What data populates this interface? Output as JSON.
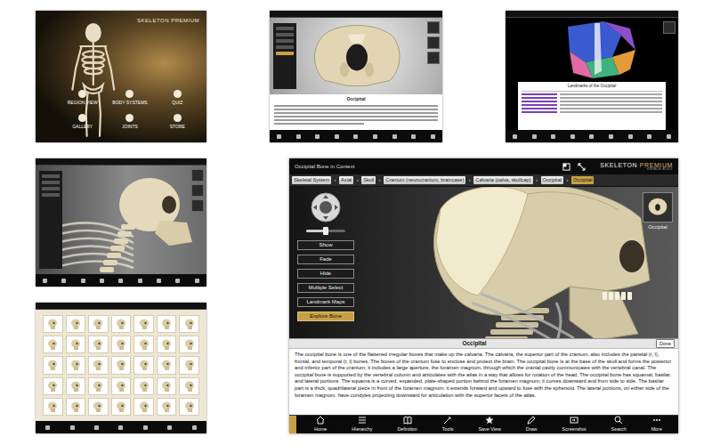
{
  "home_screen": {
    "logo": "SKELETON PREMIUM",
    "menu": [
      {
        "label": "REGION VIEW"
      },
      {
        "label": "BODY SYSTEMS"
      },
      {
        "label": "QUIZ"
      },
      {
        "label": "GALLERY"
      },
      {
        "label": "JOINTS"
      },
      {
        "label": "STORE"
      }
    ]
  },
  "bone_screen": {
    "caption": "Occipital"
  },
  "landmark_screen": {
    "title": "Landmarks of the Occipital"
  },
  "main": {
    "title": "Occipital Bone in Context",
    "logo_word1": "SKELETON",
    "logo_word2": "PREMIUM",
    "logo_sub": "VISIBLE BODY",
    "breadcrumb_separator": "›",
    "breadcrumb": [
      {
        "label": "Skeletal System",
        "selected": false
      },
      {
        "label": "Axial",
        "selected": false
      },
      {
        "label": "Skull",
        "selected": false
      },
      {
        "label": "Cranium (neurocranium, braincase)",
        "selected": false
      },
      {
        "label": "Calvaria (calva, skullcap)",
        "selected": false
      },
      {
        "label": "Occipital",
        "selected": false
      },
      {
        "label": "Occipital",
        "selected": true
      }
    ],
    "zoom_level": 0.5,
    "controls": [
      {
        "label": "Show",
        "selected": false
      },
      {
        "label": "Fade",
        "selected": false
      },
      {
        "label": "Hide",
        "selected": false
      },
      {
        "label": "Multiple Select",
        "selected": false
      },
      {
        "label": "Landmark Maps",
        "selected": false
      },
      {
        "label": "Explore Bone",
        "selected": true
      }
    ],
    "thumbnail_label": "Occipital",
    "info_title": "Occipital",
    "done": "Done",
    "description": "The occipital bone is one of the flattened irregular bones that make up the calvaria. The calvaria, the superior part of the cranium, also includes the parietal (r, l), frontal, and temporal (r, l) bones. The bones of the cranium fuse to enclose and protect the brain. The occipital bone is at the base of the skull and forms the posterior and inferior part of the cranium; it includes a large aperture, the foramen magnum, through which the cranial cavity communicates with the vertebral canal. The occipital bone is supported by the vertebral column and articulates with the atlas in a way that allows for rotation of the head. The occipital bone has squamal, basilar, and lateral portions. The squama is a curved, expanded, plate-shaped portion behind the foramen magnum; it curves downward and from side to side. The basilar part is a thick, quadrilateral piece in front of the foramen magnum; it extends forward and upward to fuse with the sphenoid. The lateral portions, on either side of the foramen magnum, have condyles projecting downward for articulation with the superior facets of the atlas.",
    "toolbar": [
      {
        "label": "Home"
      },
      {
        "label": "Hierarchy"
      },
      {
        "label": "Definition"
      },
      {
        "label": "Tools"
      },
      {
        "label": "Save View"
      },
      {
        "label": "Draw"
      },
      {
        "label": "Screenshot"
      },
      {
        "label": "Search"
      },
      {
        "label": "More"
      }
    ]
  }
}
